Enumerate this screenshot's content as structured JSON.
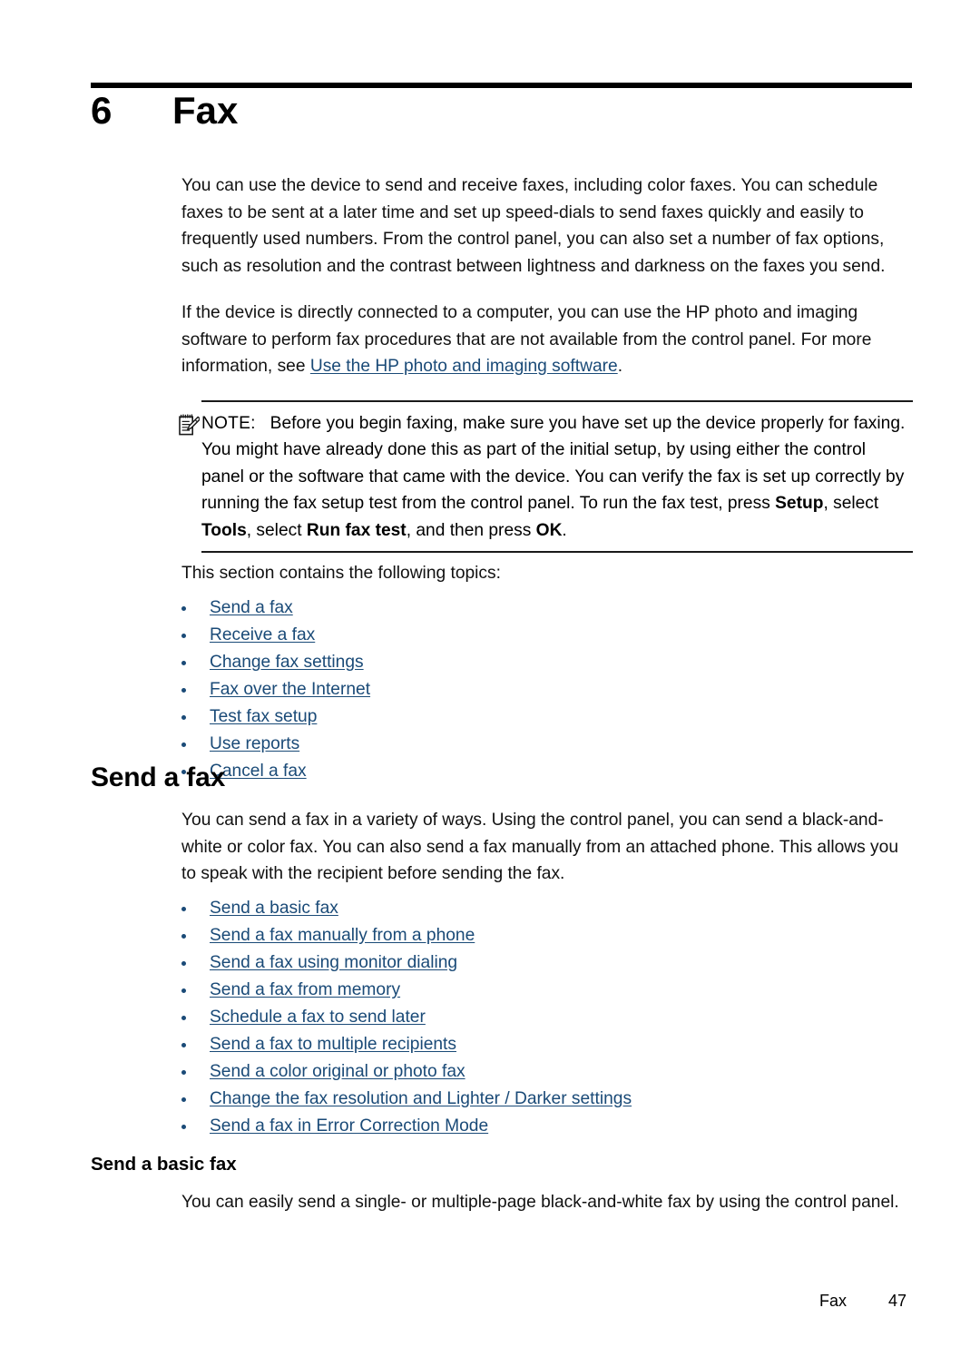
{
  "chapter": {
    "number": "6",
    "title": "Fax"
  },
  "intro": {
    "paragraph1": "You can use the device to send and receive faxes, including color faxes. You can schedule faxes to be sent at a later time and set up speed-dials to send faxes quickly and easily to frequently used numbers. From the control panel, you can also set a number of fax options, such as resolution and the contrast between lightness and darkness on the faxes you send.",
    "paragraph2_before": "If the device is directly connected to a computer, you can use the HP photo and imaging software to perform fax procedures that are not available from the control panel. For more information, see ",
    "paragraph2_link": "Use the HP photo and imaging software",
    "paragraph2_after": "."
  },
  "note": {
    "icon": "note-pencil-icon",
    "label": "NOTE:",
    "text_part1": "Before you begin faxing, make sure you have set up the device properly for faxing. You might have already done this as part of the initial setup, by using either the control panel or the software that came with the device. You can verify the fax is set up correctly by running the fax setup test from the control panel. To run the fax test, press ",
    "bold1": "Setup",
    "text_part2": ", select ",
    "bold2": "Tools",
    "text_part3": ", select ",
    "bold3": "Run fax test",
    "text_part4": ", and then press ",
    "bold4": "OK",
    "text_part5": "."
  },
  "topics_intro": "This section contains the following topics:",
  "topics": [
    {
      "label": "Send a fax"
    },
    {
      "label": "Receive a fax"
    },
    {
      "label": "Change fax settings"
    },
    {
      "label": "Fax over the Internet"
    },
    {
      "label": "Test fax setup"
    },
    {
      "label": "Use reports"
    },
    {
      "label": "Cancel a fax"
    }
  ],
  "send_a_fax": {
    "heading": "Send a fax",
    "paragraph": "You can send a fax in a variety of ways. Using the control panel, you can send a black-and-white or color fax. You can also send a fax manually from an attached phone. This allows you to speak with the recipient before sending the fax.",
    "links": [
      {
        "label": "Send a basic fax"
      },
      {
        "label": "Send a fax manually from a phone"
      },
      {
        "label": "Send a fax using monitor dialing"
      },
      {
        "label": "Send a fax from memory"
      },
      {
        "label": "Schedule a fax to send later"
      },
      {
        "label": "Send a fax to multiple recipients"
      },
      {
        "label": "Send a color original or photo fax"
      },
      {
        "label": "Change the fax resolution and Lighter / Darker settings"
      },
      {
        "label": "Send a fax in Error Correction Mode"
      }
    ]
  },
  "send_a_basic_fax": {
    "heading": "Send a basic fax",
    "paragraph": "You can easily send a single- or multiple-page black-and-white fax by using the control panel."
  },
  "footer": {
    "label": "Fax",
    "page": "47"
  },
  "colors": {
    "link": "#1a4a77",
    "text": "#111111",
    "rule": "#000000"
  }
}
